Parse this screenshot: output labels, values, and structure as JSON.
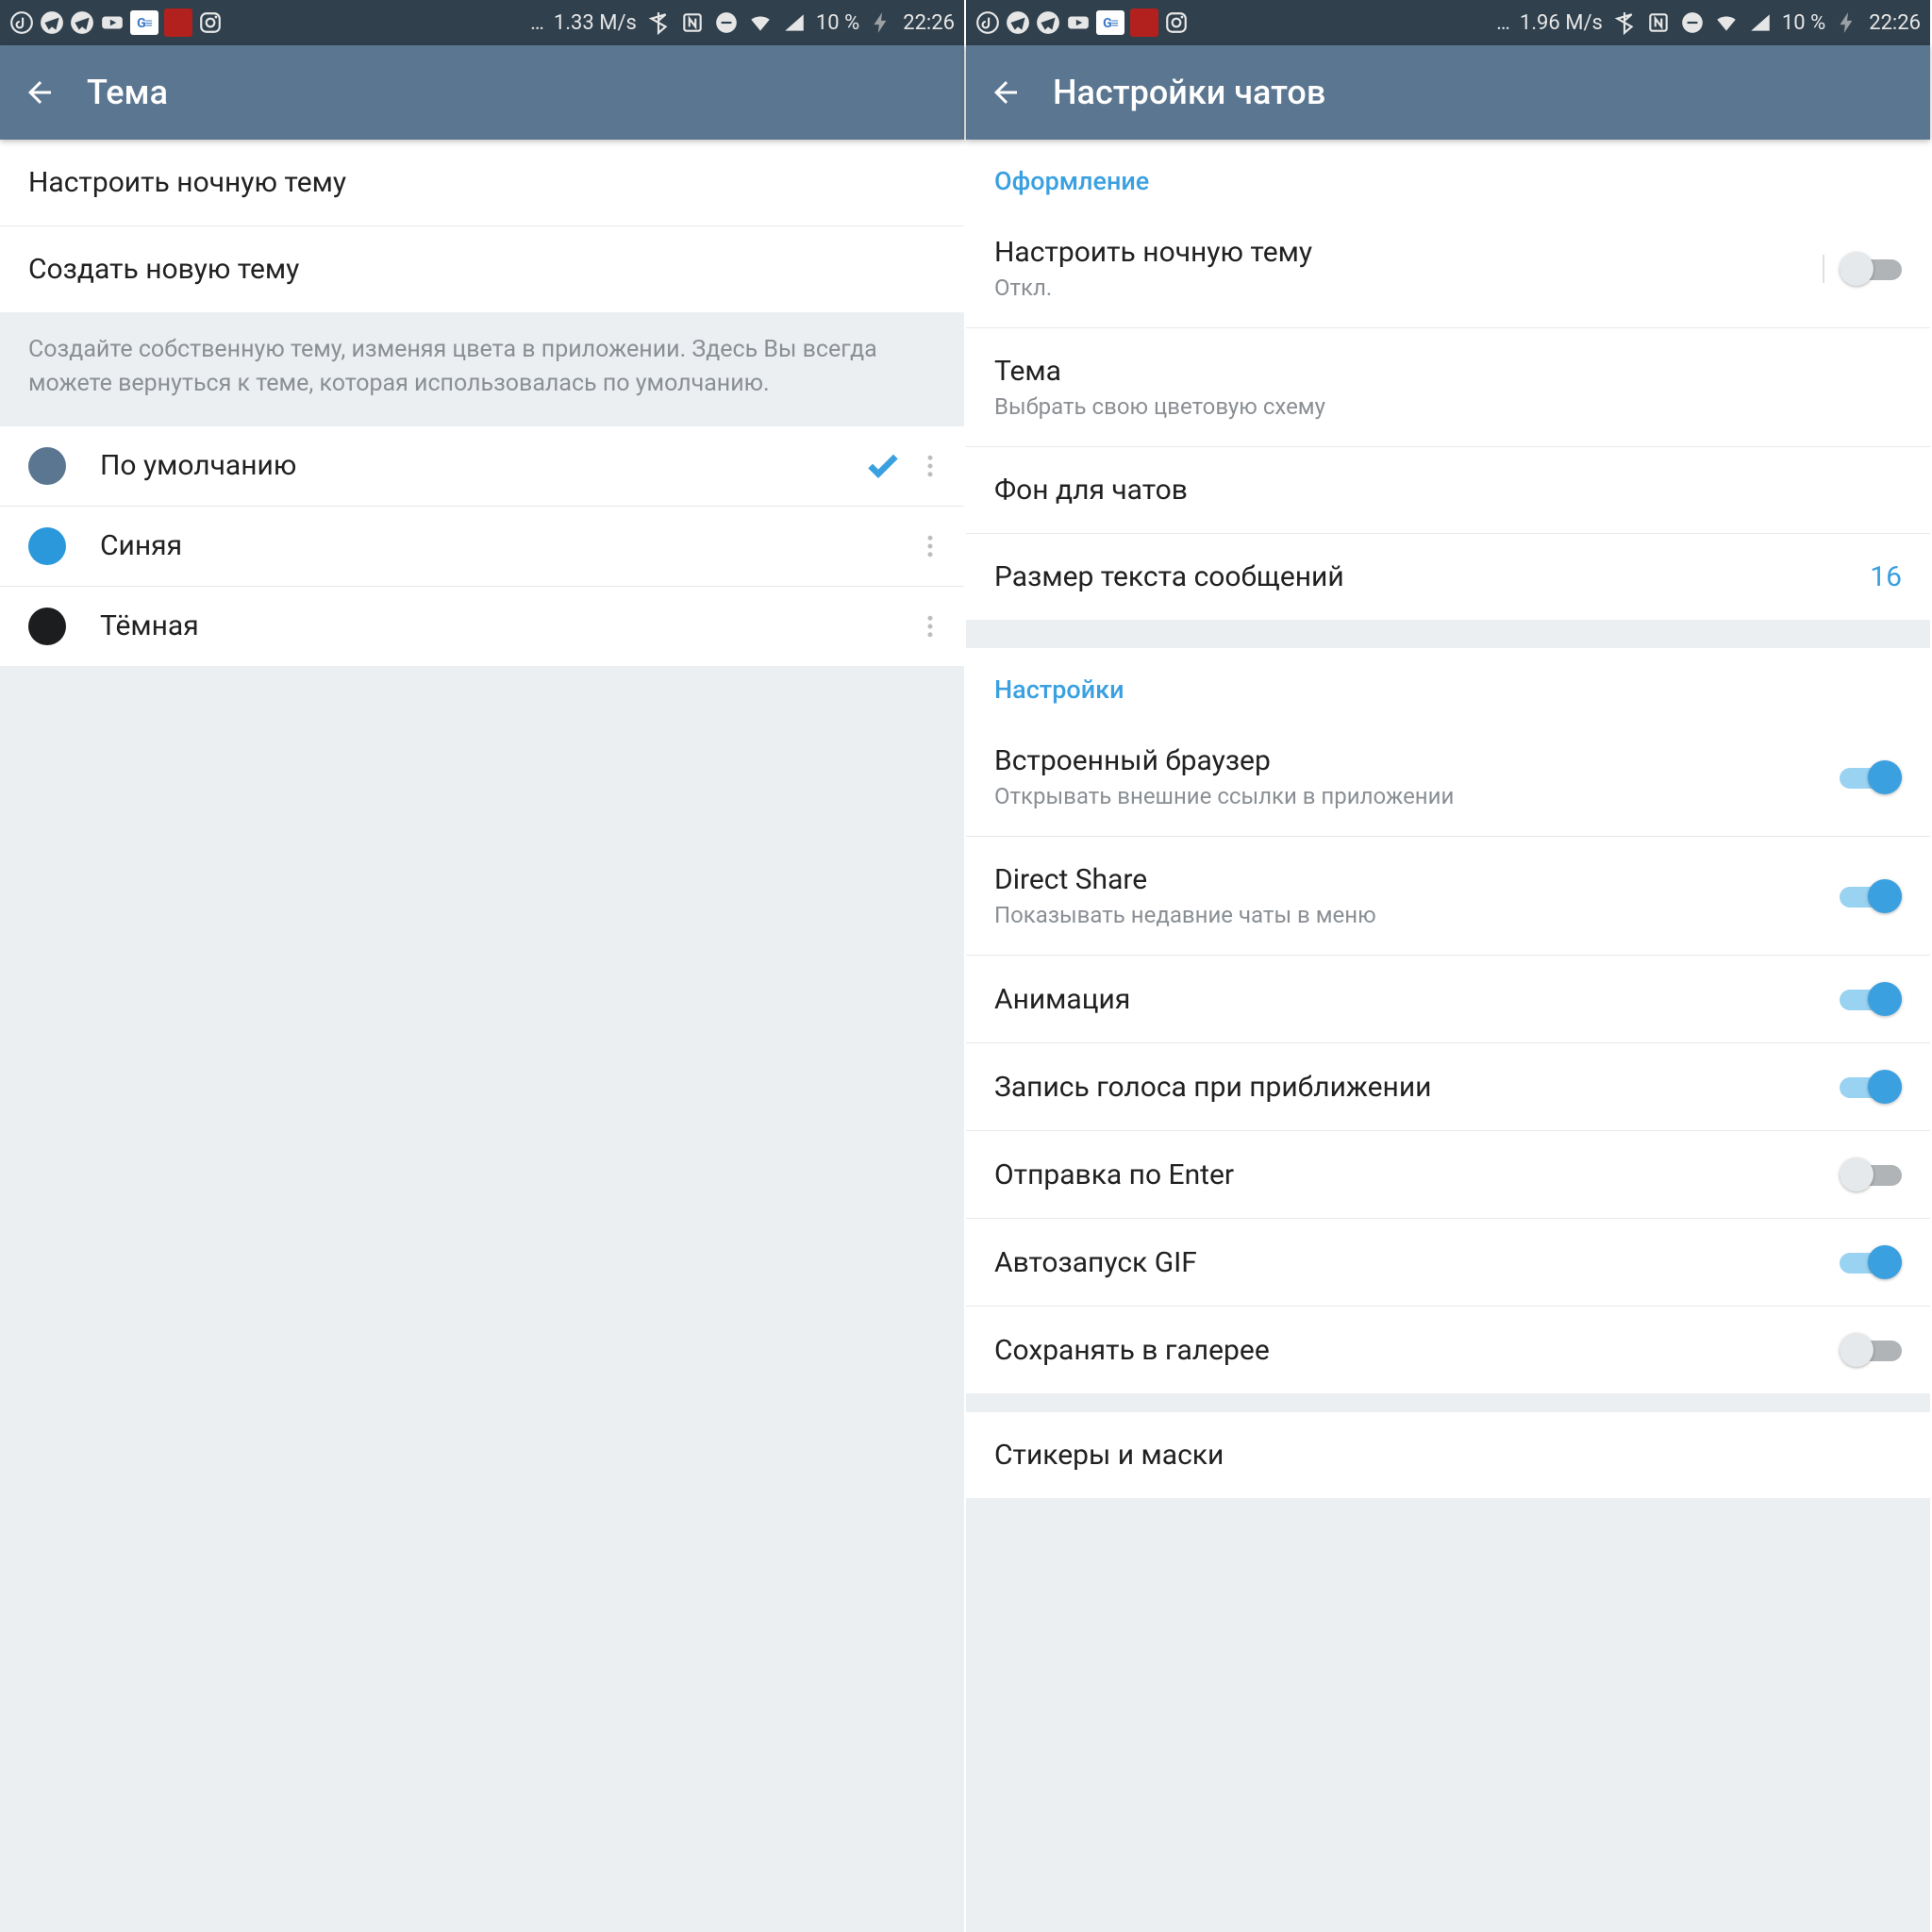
{
  "left": {
    "status": {
      "speed": "1.33 M/s",
      "battery": "10 %",
      "time": "22:26",
      "ellipsis": "…"
    },
    "title": "Тема",
    "items": [
      {
        "label": "Настроить ночную тему"
      },
      {
        "label": "Создать новую тему"
      }
    ],
    "hint": "Создайте собственную тему, изменяя цвета в приложении. Здесь Вы всегда можете вернуться к теме, которая использовалась по умолчанию.",
    "themes": [
      {
        "name": "По умолчанию",
        "color": "#5b7690",
        "selected": true
      },
      {
        "name": "Синяя",
        "color": "#2b98db",
        "selected": false
      },
      {
        "name": "Тёмная",
        "color": "#1c1d1f",
        "selected": false
      }
    ]
  },
  "right": {
    "status": {
      "speed": "1.96 M/s",
      "battery": "10 %",
      "time": "22:26",
      "ellipsis": "…"
    },
    "title": "Настройки чатов",
    "section1": {
      "header": "Оформление",
      "night": {
        "label": "Настроить ночную тему",
        "sub": "Откл.",
        "on": false
      },
      "theme": {
        "label": "Тема",
        "sub": "Выбрать свою цветовую схему"
      },
      "bg": {
        "label": "Фон для чатов"
      },
      "textsize": {
        "label": "Размер текста сообщений",
        "value": "16"
      }
    },
    "section2": {
      "header": "Настройки",
      "rows": [
        {
          "label": "Встроенный браузер",
          "sub": "Открывать внешние ссылки в приложении",
          "on": true
        },
        {
          "label": "Direct Share",
          "sub": "Показывать недавние чаты в меню",
          "on": true
        },
        {
          "label": "Анимация",
          "on": true
        },
        {
          "label": "Запись голоса при приближении",
          "on": true
        },
        {
          "label": "Отправка по Enter",
          "on": false
        },
        {
          "label": "Автозапуск GIF",
          "on": true
        },
        {
          "label": "Сохранять в галерее",
          "on": false
        }
      ]
    },
    "section3": {
      "label": "Стикеры и маски"
    }
  }
}
